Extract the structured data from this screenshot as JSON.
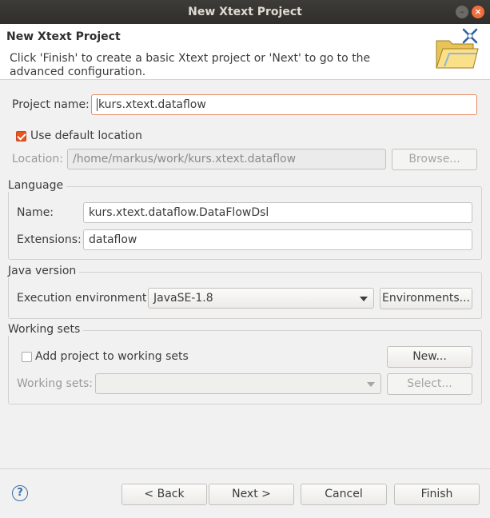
{
  "window": {
    "title": "New Xtext Project"
  },
  "banner": {
    "title": "New Xtext Project",
    "description": "Click 'Finish' to create a basic Xtext project or 'Next' to go to the advanced configuration.",
    "icon": "folder-wizard-icon"
  },
  "project": {
    "name_label": "Project name:",
    "name_value": "kurs.xtext.dataflow",
    "use_default_label": "Use default location",
    "use_default_checked": true,
    "location_label": "Location:",
    "location_value": "/home/markus/work/kurs.xtext.dataflow",
    "browse_label": "Browse..."
  },
  "language": {
    "group_title": "Language",
    "name_label": "Name:",
    "name_value": "kurs.xtext.dataflow.DataFlowDsl",
    "extensions_label": "Extensions:",
    "extensions_value": "dataflow"
  },
  "java": {
    "group_title": "Java version",
    "env_label": "Execution environment:",
    "env_value": "JavaSE-1.8",
    "environments_button": "Environments..."
  },
  "working_sets": {
    "group_title": "Working sets",
    "add_label": "Add project to working sets",
    "add_checked": false,
    "new_button": "New...",
    "sets_label": "Working sets:",
    "sets_value": "",
    "select_button": "Select..."
  },
  "footer": {
    "back": "< Back",
    "next": "Next >",
    "cancel": "Cancel",
    "finish": "Finish"
  },
  "colors": {
    "accent": "#e95420",
    "titlebar": "#2f2e2b"
  }
}
